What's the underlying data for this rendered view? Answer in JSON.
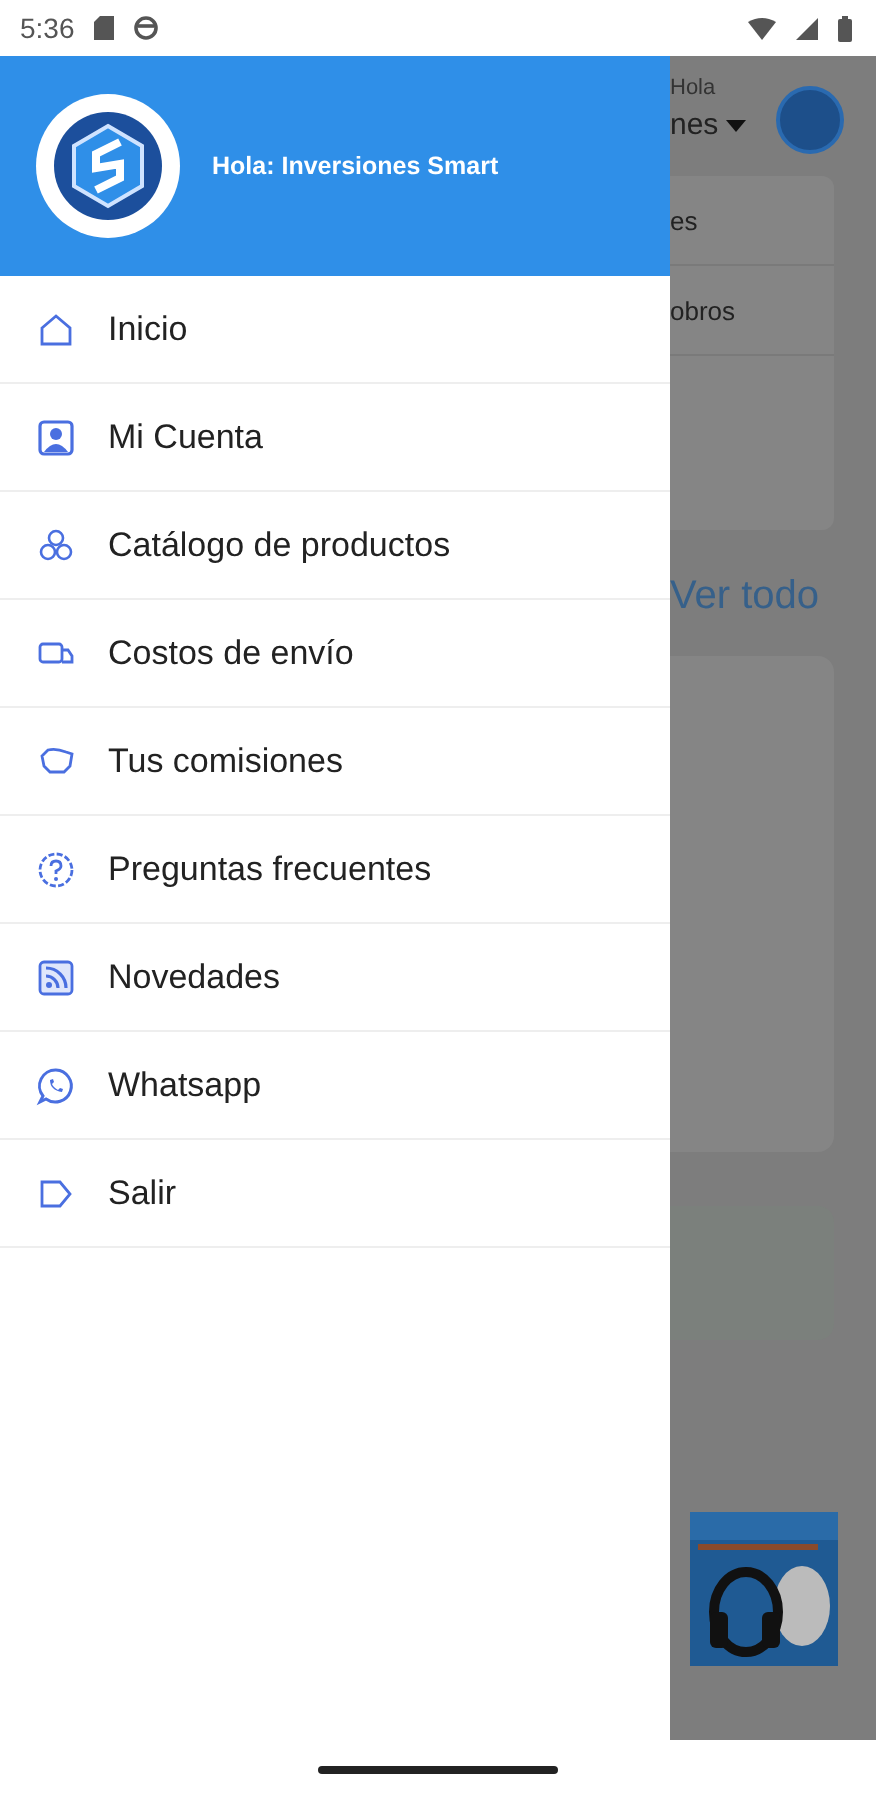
{
  "status_bar": {
    "time": "5:36"
  },
  "drawer": {
    "greeting": "Hola: Inversiones Smart",
    "items": [
      {
        "label": "Inicio",
        "kind": "home"
      },
      {
        "label": "Mi Cuenta",
        "kind": "account"
      },
      {
        "label": "Catálogo de productos",
        "kind": "catalog"
      },
      {
        "label": "Costos de envío",
        "kind": "shipping"
      },
      {
        "label": "Tus comisiones",
        "kind": "savings"
      },
      {
        "label": "Preguntas frecuentes",
        "kind": "help"
      },
      {
        "label": "Novedades",
        "kind": "feed"
      },
      {
        "label": "Whatsapp",
        "kind": "chat"
      },
      {
        "label": "Salir",
        "kind": "logout"
      }
    ]
  },
  "background": {
    "hello": "Hola",
    "user": "nes",
    "rows": [
      "es",
      "obros"
    ],
    "link": "Ver todo"
  }
}
